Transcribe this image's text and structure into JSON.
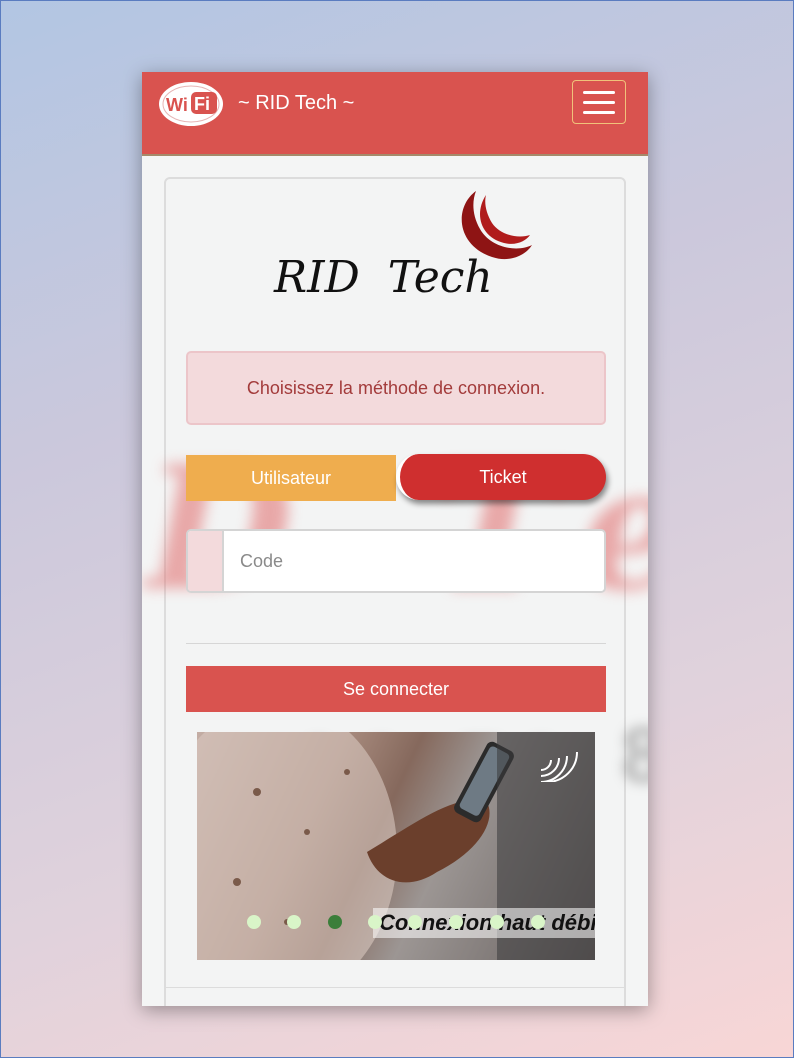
{
  "navbar": {
    "logo_text": "Wi Fi",
    "title": "~ RID Tech ~",
    "menu_icon": "hamburger-menu-icon"
  },
  "brand": {
    "logo_text": "RID  Tech",
    "logo_icon": "crescent-logo-icon"
  },
  "alert": {
    "message": "Choisissez la méthode de connexion."
  },
  "tabs": {
    "user_label": "Utilisateur",
    "ticket_label": "Ticket",
    "active": "Ticket"
  },
  "login": {
    "code_placeholder": "Code",
    "code_value": "",
    "submit_label": "Se connecter"
  },
  "carousel": {
    "caption": "Connexion haut débit",
    "slide_count": 8,
    "active_index": 2
  },
  "colors": {
    "primary": "#d9534f",
    "warning": "#efad4e",
    "danger": "#cf2f2f",
    "alert_bg": "#f3dadc"
  }
}
